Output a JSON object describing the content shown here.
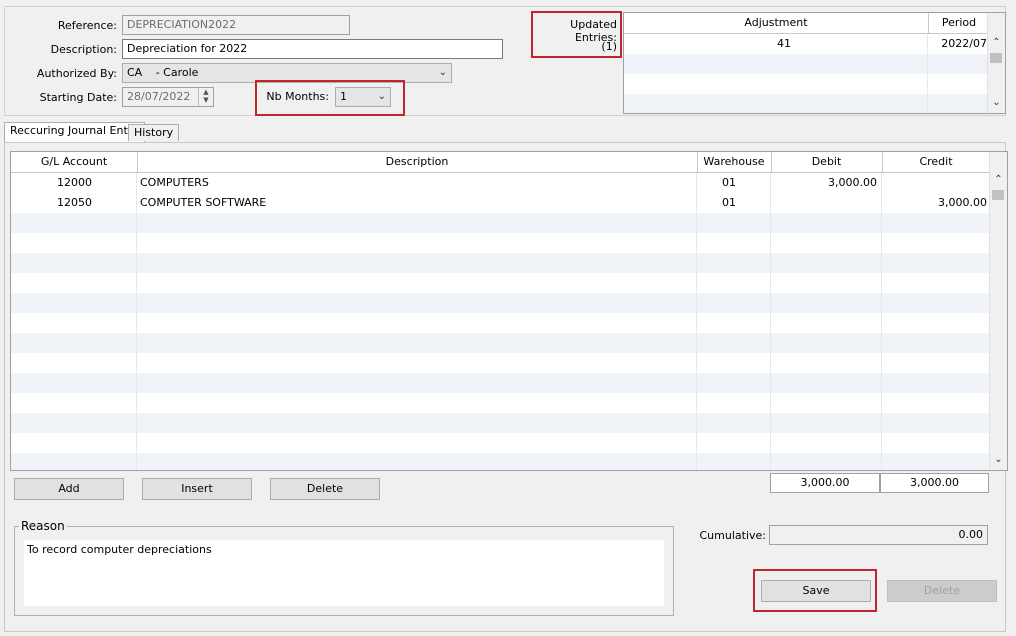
{
  "header": {
    "reference_label": "Reference:",
    "reference_value": "DEPRECIATION2022",
    "description_label": "Description:",
    "description_value": "Depreciation for 2022",
    "authorized_label": "Authorized By:",
    "authorized_code": "CA",
    "authorized_name": "- Carole",
    "starting_label": "Starting Date:",
    "starting_value": "28/07/2022",
    "nb_months_label": "Nb Months:",
    "nb_months_value": "1",
    "updated_label": "Updated Entries:",
    "updated_value": "(1)"
  },
  "updates_grid": {
    "columns": [
      "Adjustment",
      "Period"
    ],
    "rows": [
      {
        "adjustment": "41",
        "period": "2022/07"
      }
    ]
  },
  "tabs": [
    {
      "label": "Reccuring Journal Entry",
      "active": true
    },
    {
      "label": "History",
      "active": false
    }
  ],
  "lines_grid": {
    "columns": [
      "G/L Account",
      "Description",
      "Warehouse",
      "Debit",
      "Credit"
    ],
    "rows": [
      {
        "account": "12000",
        "description": "COMPUTERS",
        "warehouse": "01",
        "debit": "3,000.00",
        "credit": ""
      },
      {
        "account": "12050",
        "description": "COMPUTER SOFTWARE",
        "warehouse": "01",
        "debit": "",
        "credit": "3,000.00"
      }
    ]
  },
  "buttons": {
    "add": "Add",
    "insert": "Insert",
    "delete_line": "Delete",
    "save": "Save",
    "delete": "Delete"
  },
  "totals": {
    "debit": "3,000.00",
    "credit": "3,000.00"
  },
  "reason": {
    "legend": "Reason",
    "text": "To record computer depreciations"
  },
  "cumulative": {
    "label": "Cumulative:",
    "value": "0.00"
  },
  "colors": {
    "highlight": "#c0262e",
    "alt_row": "#f0f4f8"
  }
}
